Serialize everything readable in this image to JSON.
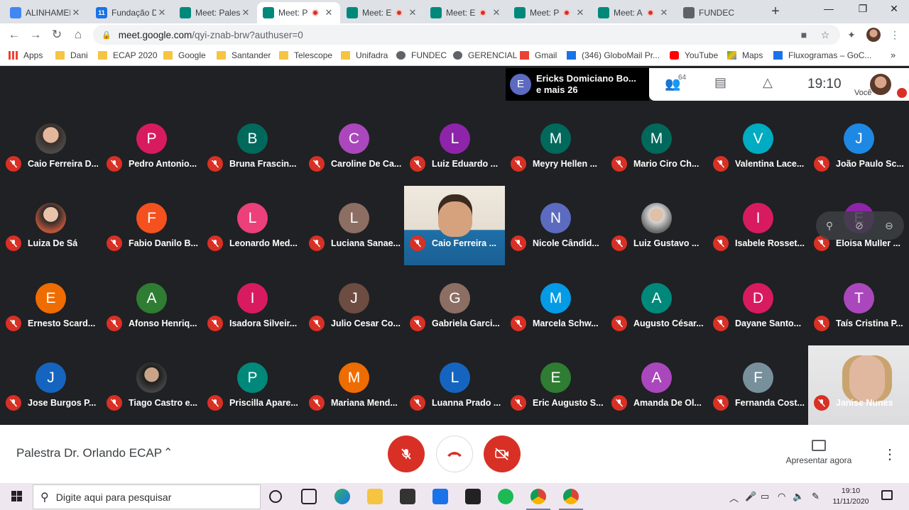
{
  "browser": {
    "tabs": [
      {
        "title": "ALINHAMENTO",
        "favicon": "docs-icon",
        "color": "#4285f4",
        "active": false,
        "recording": false
      },
      {
        "title": "Fundação D",
        "favicon": "calendar-icon",
        "color": "#1a73e8",
        "active": false,
        "recording": false,
        "badge": "11"
      },
      {
        "title": "Meet: Palestra",
        "favicon": "meet-icon",
        "color": "#00897b",
        "active": false,
        "recording": false
      },
      {
        "title": "Meet: P",
        "favicon": "meet-icon",
        "color": "#00897b",
        "active": true,
        "recording": true
      },
      {
        "title": "Meet: E",
        "favicon": "meet-icon",
        "color": "#00897b",
        "active": false,
        "recording": true
      },
      {
        "title": "Meet: E",
        "favicon": "meet-icon",
        "color": "#00897b",
        "active": false,
        "recording": true
      },
      {
        "title": "Meet: P",
        "favicon": "meet-icon",
        "color": "#00897b",
        "active": false,
        "recording": true
      },
      {
        "title": "Meet: A",
        "favicon": "meet-icon",
        "color": "#00897b",
        "active": false,
        "recording": true
      },
      {
        "title": "FUNDEC",
        "favicon": "globe-icon",
        "color": "#5f6368",
        "active": false,
        "recording": false
      }
    ],
    "url_host": "meet.google.com",
    "url_path": "/qyi-znab-brw?authuser=0",
    "bookmarks": [
      {
        "label": "Apps",
        "icon": "apps-grid-icon"
      },
      {
        "label": "Dani",
        "icon": "folder-icon"
      },
      {
        "label": "ECAP 2020",
        "icon": "folder-icon"
      },
      {
        "label": "Google",
        "icon": "folder-icon"
      },
      {
        "label": "Santander",
        "icon": "folder-icon"
      },
      {
        "label": "Telescope",
        "icon": "folder-icon"
      },
      {
        "label": "Unifadra",
        "icon": "folder-icon"
      },
      {
        "label": "FUNDEC",
        "icon": "globe-icon"
      },
      {
        "label": "GERENCIAL",
        "icon": "globe-icon"
      },
      {
        "label": "Gmail",
        "icon": "gmail-icon"
      },
      {
        "label": "(346) GloboMail Pr...",
        "icon": "globomail-icon"
      },
      {
        "label": "YouTube",
        "icon": "youtube-icon"
      },
      {
        "label": "Maps",
        "icon": "maps-icon"
      },
      {
        "label": "Fluxogramas – GoC...",
        "icon": "gocardless-icon"
      }
    ],
    "more_bookmarks": "»"
  },
  "meet": {
    "active_speaker": {
      "initial": "E",
      "line1": "Ericks Domiciano Bo...",
      "line2": "e mais 26"
    },
    "participant_count": "64",
    "clock": "19:10",
    "self_label": "Você",
    "participants": [
      {
        "name": "Caio Ferreira D...",
        "initial": "",
        "color": "",
        "photo": "photo"
      },
      {
        "name": "Pedro Antonio...",
        "initial": "P",
        "color": "#d81b60"
      },
      {
        "name": "Bruna Frascin...",
        "initial": "B",
        "color": "#00695c"
      },
      {
        "name": "Caroline De Ca...",
        "initial": "C",
        "color": "#ab47bc"
      },
      {
        "name": "Luiz Eduardo ...",
        "initial": "L",
        "color": "#8e24aa"
      },
      {
        "name": "Meyry Hellen ...",
        "initial": "M",
        "color": "#00695c"
      },
      {
        "name": "Mario Ciro Ch...",
        "initial": "M",
        "color": "#00695c"
      },
      {
        "name": "Valentina Lace...",
        "initial": "V",
        "color": "#00acc1"
      },
      {
        "name": "João Paulo Sc...",
        "initial": "J",
        "color": "#1e88e5"
      },
      {
        "name": "Luiza De Sá",
        "initial": "",
        "color": "",
        "photo": "photo2"
      },
      {
        "name": "Fabio Danilo B...",
        "initial": "F",
        "color": "#f4511e"
      },
      {
        "name": "Leonardo Med...",
        "initial": "L",
        "color": "#ec407a"
      },
      {
        "name": "Luciana Sanae...",
        "initial": "L",
        "color": "#8d6e63"
      },
      {
        "name": "Caio Ferreira ...",
        "initial": "",
        "color": "",
        "video": "video"
      },
      {
        "name": "Nicole Cândid...",
        "initial": "N",
        "color": "#5c6bc0"
      },
      {
        "name": "Luiz Gustavo ...",
        "initial": "",
        "color": "",
        "photo": "photo4"
      },
      {
        "name": "Isabele Rosset...",
        "initial": "I",
        "color": "#d81b60"
      },
      {
        "name": "Eloisa Muller ...",
        "initial": "E",
        "color": "#8e24aa"
      },
      {
        "name": "Ernesto Scard...",
        "initial": "E",
        "color": "#ef6c00"
      },
      {
        "name": "Afonso Henriq...",
        "initial": "A",
        "color": "#2e7d32"
      },
      {
        "name": "Isadora Silveir...",
        "initial": "I",
        "color": "#d81b60"
      },
      {
        "name": "Julio Cesar Co...",
        "initial": "J",
        "color": "#6d4c41"
      },
      {
        "name": "Gabriela Garci...",
        "initial": "G",
        "color": "#8d6e63"
      },
      {
        "name": "Marcela Schw...",
        "initial": "M",
        "color": "#039be5"
      },
      {
        "name": "Augusto César...",
        "initial": "A",
        "color": "#00897b"
      },
      {
        "name": "Dayane Santo...",
        "initial": "D",
        "color": "#d81b60"
      },
      {
        "name": "Taís Cristina P...",
        "initial": "T",
        "color": "#ab47bc"
      },
      {
        "name": "Jose Burgos P...",
        "initial": "J",
        "color": "#1565c0"
      },
      {
        "name": "Tiago Castro e...",
        "initial": "",
        "color": "",
        "photo": "photo3"
      },
      {
        "name": "Priscilla Apare...",
        "initial": "P",
        "color": "#00897b"
      },
      {
        "name": "Mariana Mend...",
        "initial": "M",
        "color": "#ef6c00"
      },
      {
        "name": "Luanna Prado ...",
        "initial": "L",
        "color": "#1565c0"
      },
      {
        "name": "Eric Augusto S...",
        "initial": "E",
        "color": "#2e7d32"
      },
      {
        "name": "Amanda De Ol...",
        "initial": "A",
        "color": "#ab47bc"
      },
      {
        "name": "Fernanda Cost...",
        "initial": "F",
        "color": "#78909c"
      },
      {
        "name": "Janise Nunes",
        "initial": "",
        "color": "",
        "video": "video2"
      }
    ],
    "meeting_title": "Palestra Dr. Orlando ECAP",
    "present_label": "Apresentar agora"
  },
  "taskbar": {
    "search_placeholder": "Digite aqui para pesquisar",
    "time": "19:10",
    "date": "11/11/2020"
  }
}
